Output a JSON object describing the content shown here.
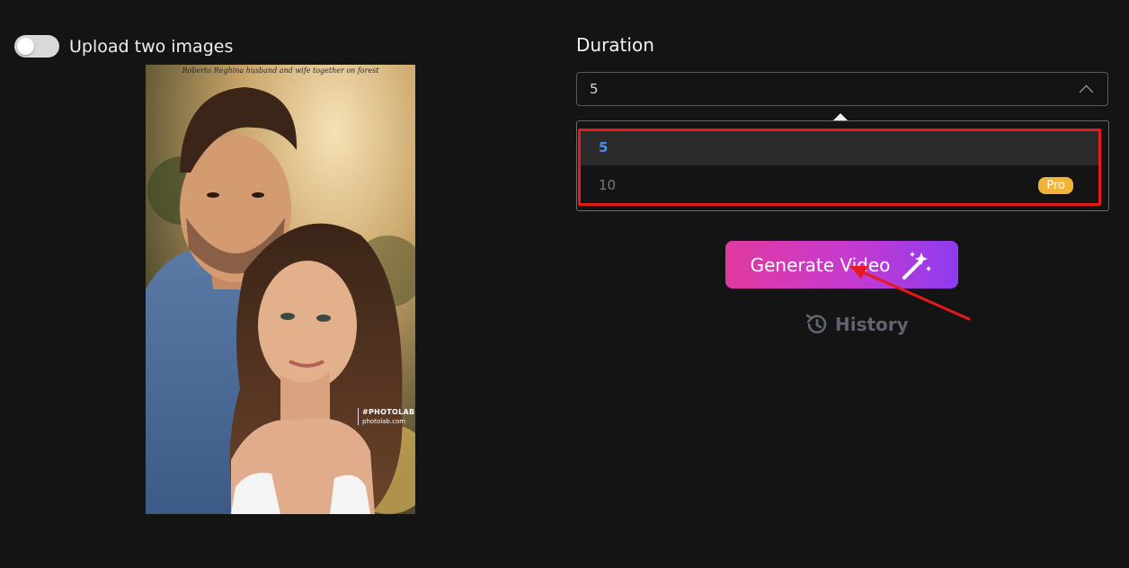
{
  "upload_toggle": {
    "label": "Upload two images",
    "checked": false
  },
  "photo": {
    "caption": "Roberto Reghina husband and wife together on forest",
    "watermark_brand": "#PHOTOLAB",
    "watermark_site": "photolab.com"
  },
  "duration": {
    "label": "Duration",
    "selected": "5",
    "options": [
      {
        "label": "5",
        "badge": ""
      },
      {
        "label": "10",
        "badge": "Pro"
      }
    ]
  },
  "generate_button": {
    "label": "Generate Video",
    "icon": "magic-wand-icon"
  },
  "history": {
    "label": "History",
    "icon": "history-icon"
  },
  "colors": {
    "background": "#141414",
    "accent_blue": "#4a90f0",
    "pro_badge": "#f2b338",
    "highlight_red": "#e8191c",
    "gradient_start": "#e13aa0",
    "gradient_end": "#8d3cf0"
  }
}
